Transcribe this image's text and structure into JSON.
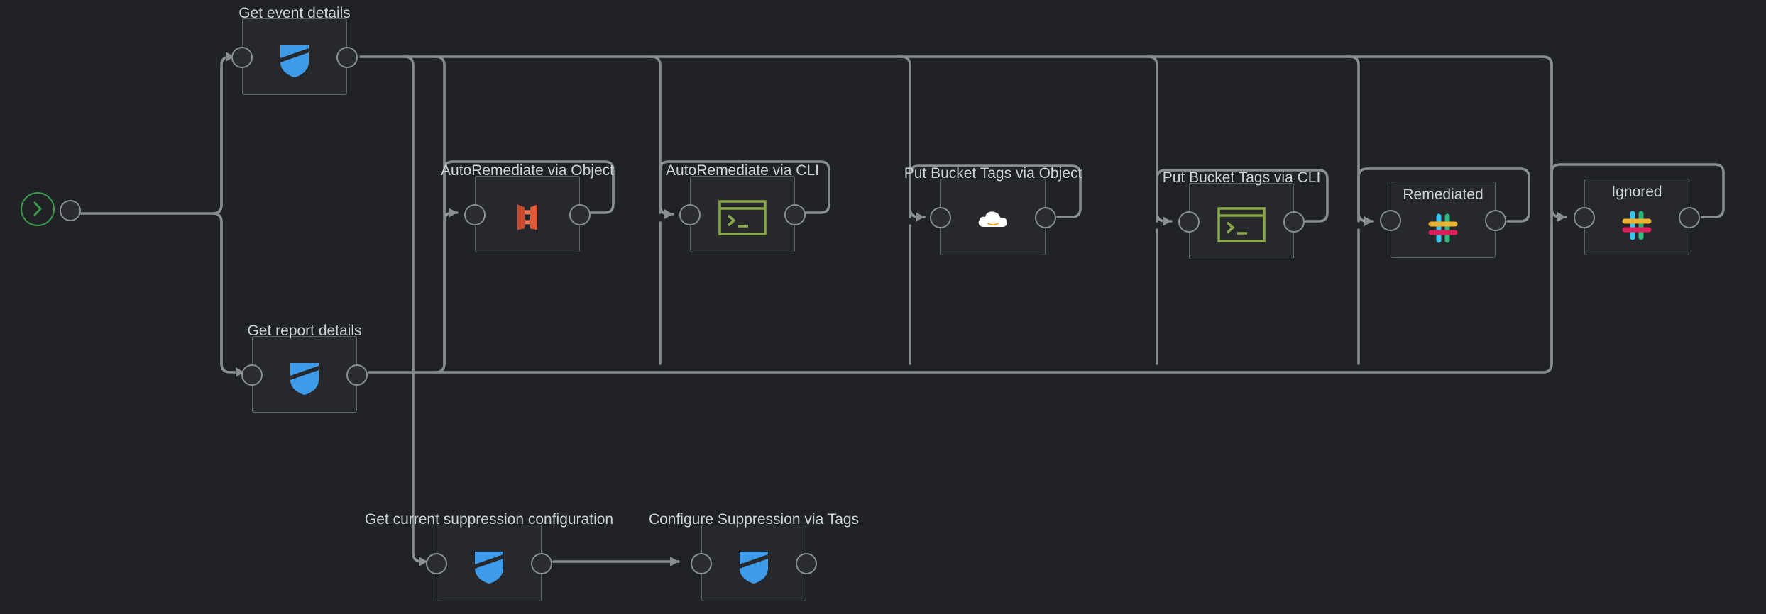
{
  "workflow": {
    "nodes": [
      {
        "id": "get_event",
        "label": "Get event details",
        "icon": "shield-icon"
      },
      {
        "id": "get_report",
        "label": "Get report details",
        "icon": "shield-icon"
      },
      {
        "id": "auto_obj",
        "label": "AutoRemediate via Object",
        "icon": "aws-lambda-icon"
      },
      {
        "id": "auto_cli",
        "label": "AutoRemediate via CLI",
        "icon": "terminal-icon"
      },
      {
        "id": "tags_obj",
        "label": "Put Bucket Tags via Object",
        "icon": "aws-cloud-icon"
      },
      {
        "id": "tags_cli",
        "label": "Put Bucket Tags via CLI",
        "icon": "terminal-icon"
      },
      {
        "id": "remediated",
        "label": "Remediated",
        "icon": "slack-icon"
      },
      {
        "id": "ignored",
        "label": "Ignored",
        "icon": "slack-icon"
      },
      {
        "id": "get_supp",
        "label": "Get current suppression configuration",
        "icon": "shield-icon"
      },
      {
        "id": "conf_supp",
        "label": "Configure Suppression via Tags",
        "icon": "shield-icon"
      }
    ],
    "colors": {
      "background": "#202226",
      "connector": "#8a8e93",
      "start": "#3a9a4a",
      "shield": "#3d9be9",
      "terminal": "#8aa84a",
      "lambda": "#e05a3a"
    }
  }
}
